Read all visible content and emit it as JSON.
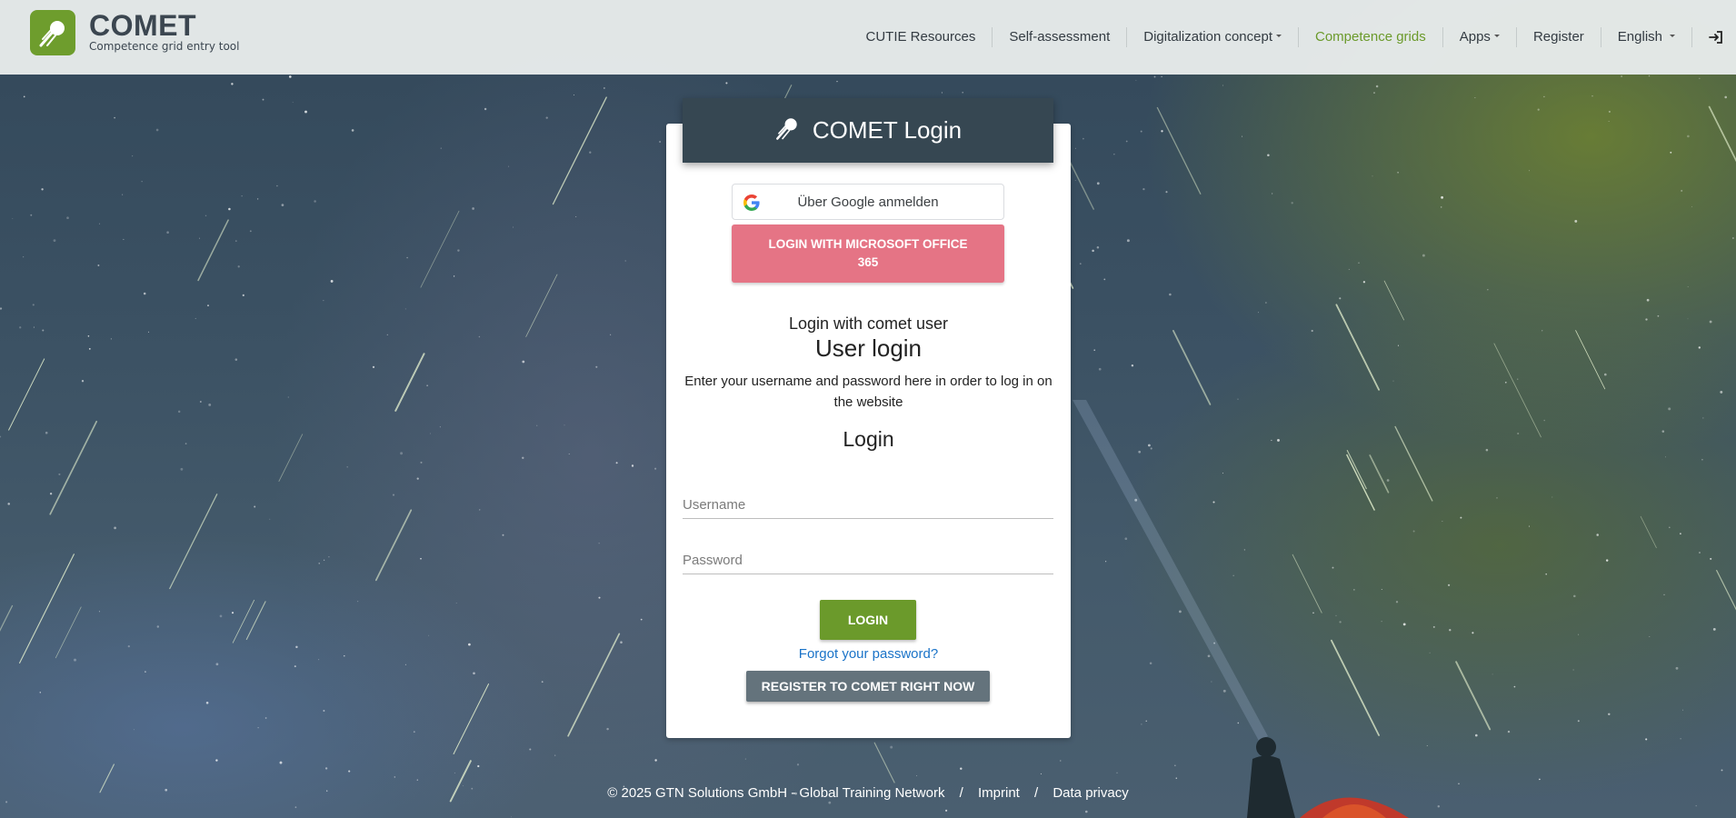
{
  "brand": {
    "title": "COMET",
    "subtitle": "Competence grid entry tool",
    "logo_icon": "comet-icon",
    "accent_color": "#6e9d2d"
  },
  "nav": {
    "items": [
      {
        "label": "CUTIE Resources"
      },
      {
        "label": "Self-assessment"
      },
      {
        "label": "Digitalization concept"
      },
      {
        "label": "Competence grids"
      },
      {
        "label": "Apps"
      },
      {
        "label": "Register"
      },
      {
        "label": "English"
      }
    ],
    "login_icon": "sign-in-icon",
    "active_color": "#6b9a2b"
  },
  "login": {
    "header_title": "COMET Login",
    "header_icon": "comet-icon",
    "google_label": "Über Google anmelden",
    "microsoft_label": "LOGIN WITH MICROSOFT OFFICE 365",
    "login_with_text": "Login with comet user",
    "user_login_title": "User login",
    "description": "Enter your username and password here in order to log in on the website",
    "login_heading": "Login",
    "username_placeholder": "Username",
    "password_placeholder": "Password",
    "login_button": "LOGIN",
    "forgot_link": "Forgot your password?",
    "register_button": "REGISTER TO COMET RIGHT NOW"
  },
  "footer": {
    "copyright": "© 2025 GTN Solutions GmbH - Global Training Network",
    "separator": "/",
    "imprint": "Imprint",
    "privacy": "Data privacy"
  }
}
